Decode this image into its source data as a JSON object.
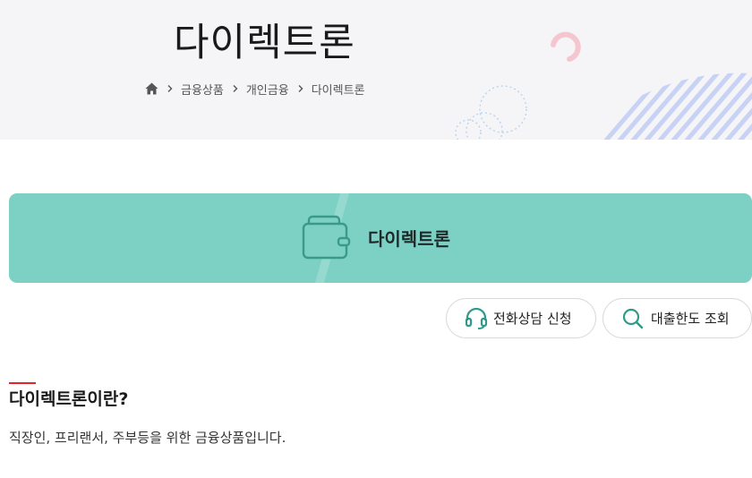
{
  "header": {
    "title": "다이렉트론",
    "breadcrumb": {
      "home_icon": "home-icon",
      "separator_icon": "chevron-right-icon",
      "items": [
        "금융상품",
        "개인금융",
        "다이렉트론"
      ]
    }
  },
  "banner": {
    "icon": "wallet-icon",
    "title": "다이렉트론",
    "background_color": "#7dd0c4",
    "icon_color": "#3a9a88"
  },
  "actions": {
    "consult": {
      "icon": "headset-icon",
      "label": "전화상담 신청"
    },
    "limit": {
      "icon": "search-icon",
      "label": "대출한도 조회"
    },
    "icon_color": "#2f9a8a"
  },
  "section": {
    "accent_color": "#e5242a",
    "title": "다이렉트론이란?",
    "description": "직장인, 프리랜서, 주부등을 위한 금융상품입니다."
  }
}
